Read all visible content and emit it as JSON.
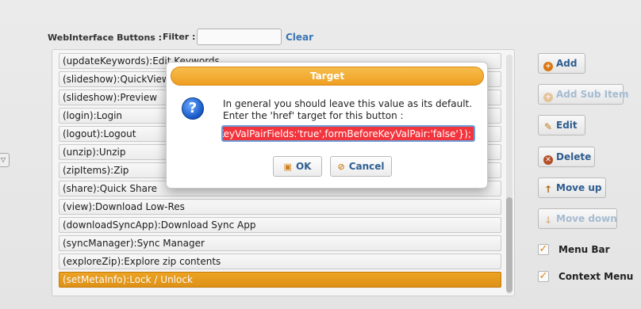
{
  "header": {
    "title": "WebInterface Buttons :",
    "filter_label": "Filter :",
    "filter_value": "",
    "clear_label": "Clear"
  },
  "list": {
    "items": [
      "(updateKeywords):Edit Keywords",
      "(slideshow):QuickView",
      "(slideshow):Preview",
      "(login):Login",
      "(logout):Logout",
      "(unzip):Unzip",
      "(zipItems):Zip",
      "(share):Quick Share",
      "(view):Download Low-Res",
      "(downloadSyncApp):Download Sync App",
      "(syncManager):Sync Manager",
      "(exploreZip):Explore zip contents",
      "(setMetaInfo):Lock / Unlock"
    ],
    "selected_index": 12
  },
  "side_buttons": {
    "add": "Add",
    "add_sub_item": "Add Sub Item",
    "edit": "Edit",
    "delete": "Delete",
    "move_up": "Move up",
    "move_down": "Move down"
  },
  "checkboxes": {
    "menu_bar": "Menu Bar",
    "context_menu": "Context Menu"
  },
  "dialog": {
    "title": "Target",
    "line1": "In general you should leave this value as its default.",
    "line2": "Enter the 'href' target for this button :",
    "input_value": ", noKeyValPairFields:'true',formBeforeKeyValPair:'false'});",
    "ok_label": "OK",
    "cancel_label": "Cancel"
  },
  "colors": {
    "accent": "#ee9f22",
    "link": "#3a78b8",
    "error_field": "#f2343d"
  }
}
